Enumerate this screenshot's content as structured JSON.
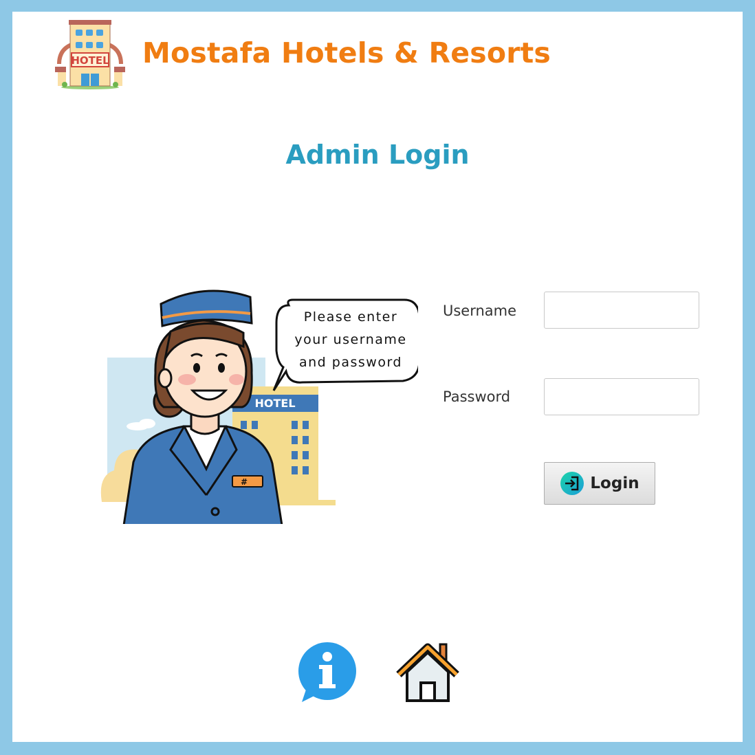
{
  "header": {
    "app_title": "Mostafa Hotels & Resorts",
    "logo_sign_text": "HOTEL"
  },
  "page": {
    "title": "Admin Login"
  },
  "illustration": {
    "speech_lines": [
      "Please enter",
      "your username",
      "and password"
    ],
    "building_sign": "HOTEL",
    "badge_text": "#"
  },
  "form": {
    "username_label": "Username",
    "username_value": "",
    "password_label": "Password",
    "password_value": "",
    "login_label": "Login"
  },
  "footer": {
    "info_icon": "info-icon",
    "home_icon": "home-icon"
  },
  "colors": {
    "frame": "#8ec8e6",
    "brand_orange": "#f07d12",
    "title_blue": "#2a9dc0"
  }
}
